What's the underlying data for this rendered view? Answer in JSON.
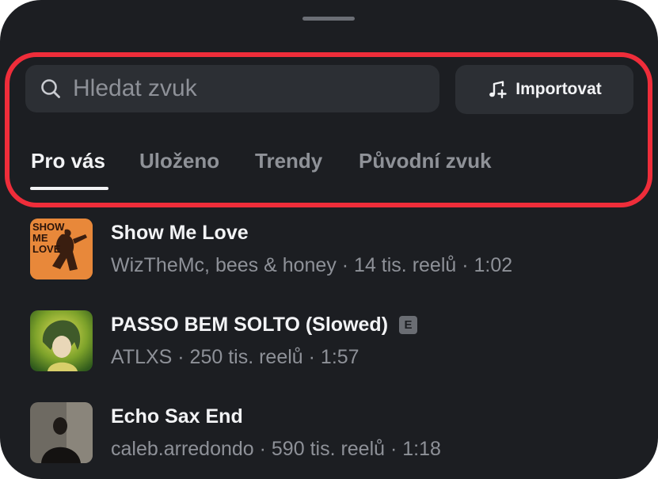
{
  "search": {
    "placeholder": "Hledat zvuk",
    "icon": "search-icon"
  },
  "import_button": {
    "label": "Importovat",
    "icon": "music-note-plus-icon"
  },
  "tabs": [
    {
      "label": "Pro vás",
      "active": true
    },
    {
      "label": "Uloženo",
      "active": false
    },
    {
      "label": "Trendy",
      "active": false
    },
    {
      "label": "Původní zvuk",
      "active": false
    }
  ],
  "tracks": [
    {
      "title": "Show Me Love",
      "meta": "WizTheMc, bees & honey · 14 tis. reelů · 1:02",
      "explicit": false,
      "cover_text": [
        "SHOW",
        "ME",
        "LOVE"
      ]
    },
    {
      "title": "PASSO BEM SOLTO (Slowed)",
      "meta": "ATLXS · 250 tis. reelů · 1:57",
      "explicit": true,
      "explicit_label": "E"
    },
    {
      "title": "Echo Sax End",
      "meta": "caleb.arredondo · 590 tis. reelů · 1:18",
      "explicit": false
    }
  ],
  "colors": {
    "sheet_background": "#1c1e22",
    "highlight_border": "#ef2d3a",
    "control_background": "#2c2f34",
    "active_tab": "#f2f3f5",
    "inactive_tab": "#8f9298"
  }
}
